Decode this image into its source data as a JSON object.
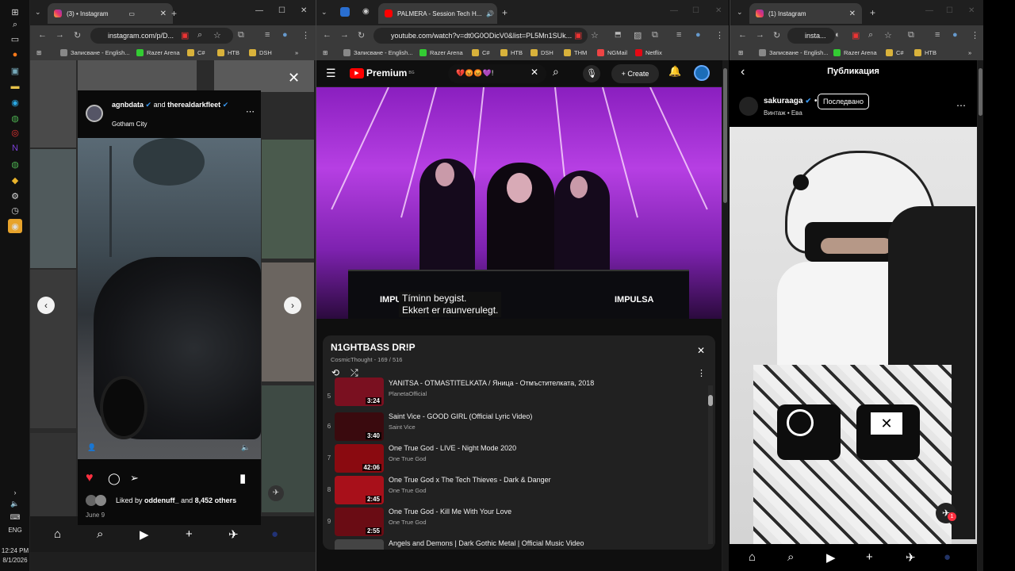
{
  "taskbar": {
    "time": "12:24 PM",
    "date": "8/1/2026",
    "lang": "ENG",
    "icons": [
      "windows-icon",
      "search-icon",
      "task-view-icon",
      "firefox-icon",
      "photos-icon",
      "explorer-icon",
      "edge-icon",
      "chrome-icon",
      "app-red-icon",
      "onenote-icon",
      "chrome-icon-2",
      "app-yellow-icon",
      "app-gear-icon",
      "app-clock-icon",
      "app-active-icon"
    ]
  },
  "left_window": {
    "tab_title": "(3) • Instagram",
    "tab_count": "3",
    "url": "instagram.com/p/D...",
    "bookmarks": [
      "Записване - English...",
      "Razer Arena",
      "C#",
      "НТВ",
      "DSH"
    ],
    "post": {
      "user1": "agnbdata",
      "joiner": "and",
      "user2": "therealdarkfleet",
      "location": "Gotham City",
      "liked_by_prefix": "Liked by",
      "liked_by_user": "oddenuff_",
      "liked_by_and": "and",
      "liked_by_others": "8,452 others",
      "date": "June 9"
    }
  },
  "middle_window": {
    "tab_title": "PALMERA - Session Tech H...",
    "url": "youtube.com/watch?v=dt0G0ODicV0&list=PL5Mn1SUk...",
    "bookmarks": [
      "Записване - English...",
      "Razer Arena",
      "C#",
      "НТВ",
      "DSH",
      "THM",
      "NGMail",
      "Netflix"
    ],
    "yt": {
      "logo": "Premium",
      "logo_region": "BG",
      "search_value": "💔😡😡💜!",
      "create_label": "Create",
      "caption_line1": "Tíminn beygist.",
      "caption_line2": "Ekkert er raunverulegt.",
      "watermark": "IMPULSA"
    },
    "playlist": {
      "title": "N1GHTBASS DR!P",
      "meta": "CosmicThought - 169 / 516",
      "items": [
        {
          "num": "",
          "title": "YANITSA - OTMASTITELKATA / Яница - Отмъстителката, 2018",
          "channel": "PlanetaOfficial",
          "duration": "3:24"
        },
        {
          "num": "6",
          "title": "Saint Vice - GOOD GIRL (Official Lyric Video)",
          "channel": "Saint Vice",
          "duration": "3:40"
        },
        {
          "num": "7",
          "title": "One True God - LIVE - Night Mode 2020",
          "channel": "One True God",
          "duration": "42:06"
        },
        {
          "num": "8",
          "title": "One True God x The Tech Thieves - Dark & Danger",
          "channel": "One True God",
          "duration": "2:45"
        },
        {
          "num": "9",
          "title": "One True God - Kill Me With Your Love",
          "channel": "One True God",
          "duration": "2:55"
        },
        {
          "num": "",
          "title": "Angels and Demons | Dark Gothic Metal | Official Music Video",
          "channel": "",
          "duration": ""
        }
      ],
      "first_num": "5"
    }
  },
  "right_window": {
    "tab_title": "(1) Instagram",
    "url": "insta...",
    "bookmarks": [
      "Записване - English...",
      "Razer Arena",
      "C#",
      "НТВ"
    ],
    "header_title": "Публикация",
    "username": "sakuraaga",
    "follow_label": "Последвано",
    "subtitle": "Винтаж • Ева",
    "notif_count": "1"
  },
  "colors": {
    "yt_red": "#ff0000",
    "ig_blue": "#3897f0",
    "like_red": "#ff3040"
  }
}
